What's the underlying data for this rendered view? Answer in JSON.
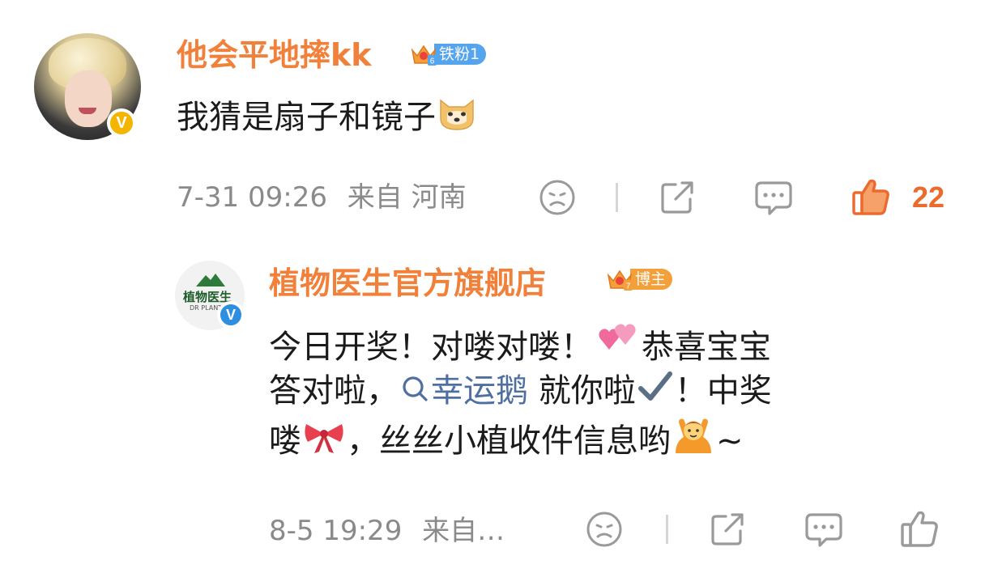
{
  "comments": [
    {
      "username": "他会平地摔kk",
      "badge_label": "铁粉1",
      "badge_level": "6",
      "verified_label": "V",
      "text": "我猜是扇子和镜子",
      "text_emoji": "doge-emoji",
      "timestamp": "7-31 09:26",
      "source": "来自 河南",
      "like_count": "22"
    }
  ],
  "reply": {
    "username": "植物医生官方旗舰店",
    "badge_label": "博主",
    "badge_level": "7",
    "verified_label": "V",
    "avatar_brand": "植物医生",
    "avatar_brand_sub": "DR PLANT",
    "line1_text": "今日开奖！对喽对喽！",
    "line1_after": "恭喜宝宝",
    "line2_before": "答对啦，",
    "topic": "幸运鹅",
    "line2_after": " 就你啦",
    "line2_end": "！中奖",
    "line3_before": "喽",
    "line3_mid": "，丝丝小植收件信息哟",
    "line3_end": "~",
    "timestamp": "8-5 19:29",
    "source": "来自…"
  },
  "colors": {
    "username": "#f0803a",
    "meta": "#8a8a8a",
    "topic": "#4f6fa1",
    "like_active": "#eb6a2e",
    "fan_badge": "#54a4ee",
    "host_badge": "#f3a03a"
  },
  "icons": [
    "sad-face-icon",
    "share-icon",
    "comment-icon",
    "thumbs-up-icon",
    "search-icon"
  ]
}
